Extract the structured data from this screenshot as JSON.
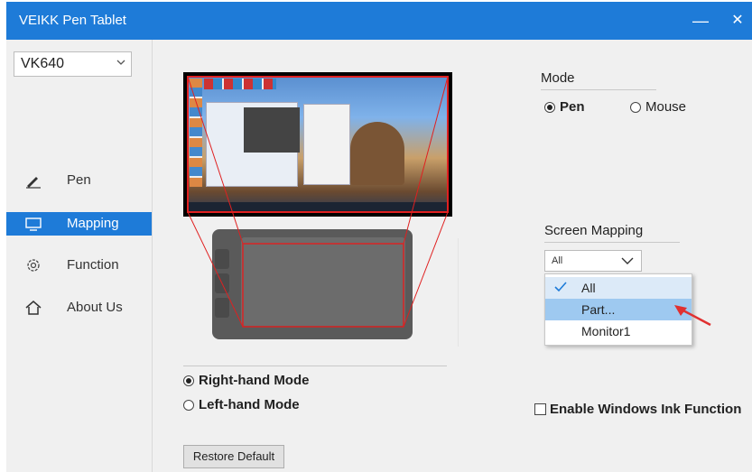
{
  "window": {
    "title": "VEIKK Pen Tablet",
    "minimize": "—",
    "close": "✕"
  },
  "sidebar": {
    "device": "VK640",
    "items": [
      {
        "label": "Pen",
        "icon": "pen-icon"
      },
      {
        "label": "Mapping",
        "icon": "monitor-icon"
      },
      {
        "label": "Function",
        "icon": "gear-icon"
      },
      {
        "label": "About Us",
        "icon": "home-icon"
      }
    ],
    "active_item": "Mapping"
  },
  "mode": {
    "title": "Mode",
    "options": [
      "Pen",
      "Mouse"
    ],
    "selected": "Pen"
  },
  "screen_mapping": {
    "title": "Screen Mapping",
    "value": "All",
    "options": [
      "All",
      "Part...",
      "Monitor1"
    ],
    "checked_option": "All",
    "highlighted_option": "Part..."
  },
  "hand_mode": {
    "options": [
      "Right-hand Mode",
      "Left-hand Mode"
    ],
    "selected": "Right-hand Mode"
  },
  "windows_ink": {
    "label": "Enable Windows Ink Function",
    "checked": false
  },
  "restore_button": "Restore Default",
  "colors": {
    "accent": "#1e7bd8",
    "mapping_lines": "#e02020",
    "highlight": "#9ec9f0",
    "arrow": "#e03030"
  }
}
